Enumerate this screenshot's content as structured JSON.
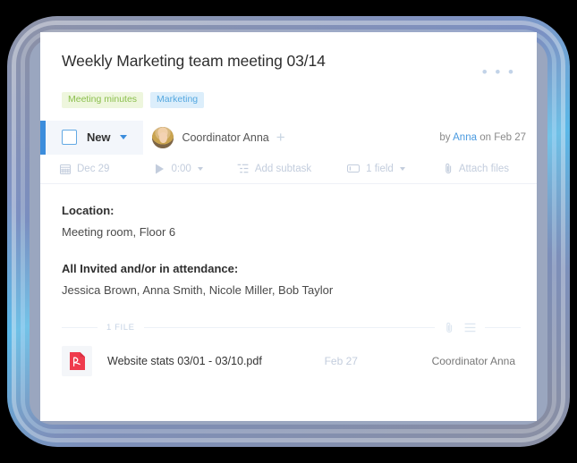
{
  "card": {
    "title": "Weekly Marketing team meeting 03/14",
    "overflow_menu": "• • •",
    "tags": [
      {
        "label": "Meeting minutes",
        "color": "#8bbf4d",
        "background": "#eef6dd"
      },
      {
        "label": "Marketing",
        "color": "#55a8e0",
        "background": "#dceefb"
      }
    ]
  },
  "status_row": {
    "accent_color": "#3c8ddc",
    "status_label": "New",
    "assignee_name": "Coordinator Anna",
    "add_assignee": "+",
    "byline_prefix": "by",
    "byline_author": "Anna",
    "byline_middle": "on",
    "byline_date": "Feb 27"
  },
  "meta_toolbar": [
    {
      "icon": "calendar-icon",
      "label": "Dec 29",
      "has_caret": false
    },
    {
      "icon": "play-icon",
      "label": "0:00",
      "has_caret": true
    },
    {
      "icon": "subtask-icon",
      "label": "Add subtask",
      "has_caret": false
    },
    {
      "icon": "field-icon",
      "label": "1 field",
      "has_caret": true
    },
    {
      "icon": "paperclip-icon",
      "label": "Attach files",
      "has_caret": false
    }
  ],
  "body": {
    "location_label": "Location:",
    "location_value": "Meeting room, Floor 6",
    "attendance_label": "All Invited and/or in attendance:",
    "attendance_value": "Jessica Brown, Anna Smith, Nicole Miller, Bob Taylor"
  },
  "files": {
    "count_label": "1 FILE",
    "items": [
      {
        "name": "Website stats 03/01 - 03/10.pdf",
        "type": "pdf",
        "date": "Feb 27",
        "owner": "Coordinator Anna",
        "icon_color": "#ef3b4d"
      }
    ]
  }
}
